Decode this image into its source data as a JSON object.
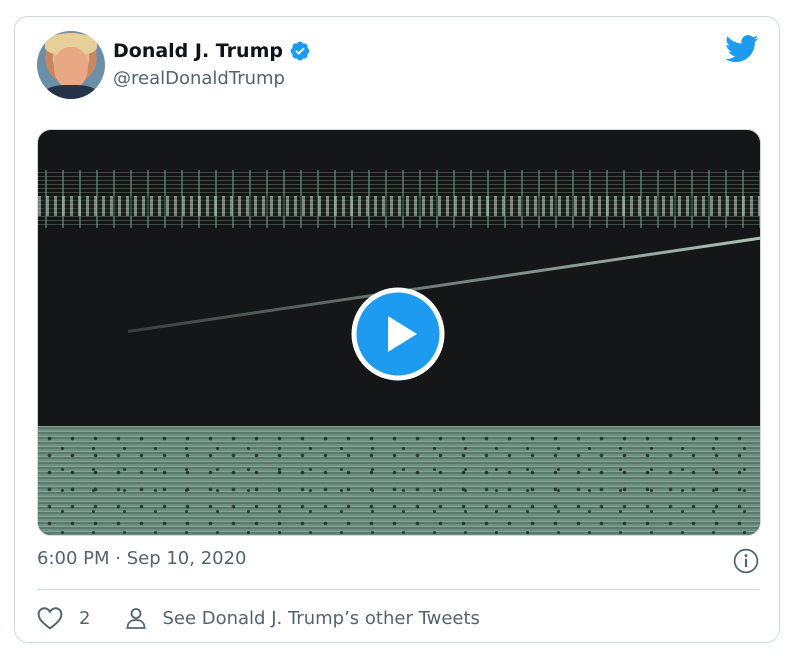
{
  "tweet": {
    "author_name": "Donald J. Trump",
    "author_handle": "@realDonaldTrump",
    "timestamp": "6:00 PM · Sep 10, 2020",
    "like_count": "2",
    "other_tweets_link": "See Donald J. Trump’s other Tweets"
  },
  "icons": {
    "verified": "verified-badge-icon",
    "logo": "twitter-bird-icon",
    "play": "play-icon",
    "info": "info-icon",
    "like": "heart-icon",
    "profile": "person-icon"
  },
  "colors": {
    "accent": "#1d9bf0",
    "text_primary": "#0f1419",
    "text_secondary": "#536471",
    "border": "#cfd9de"
  }
}
